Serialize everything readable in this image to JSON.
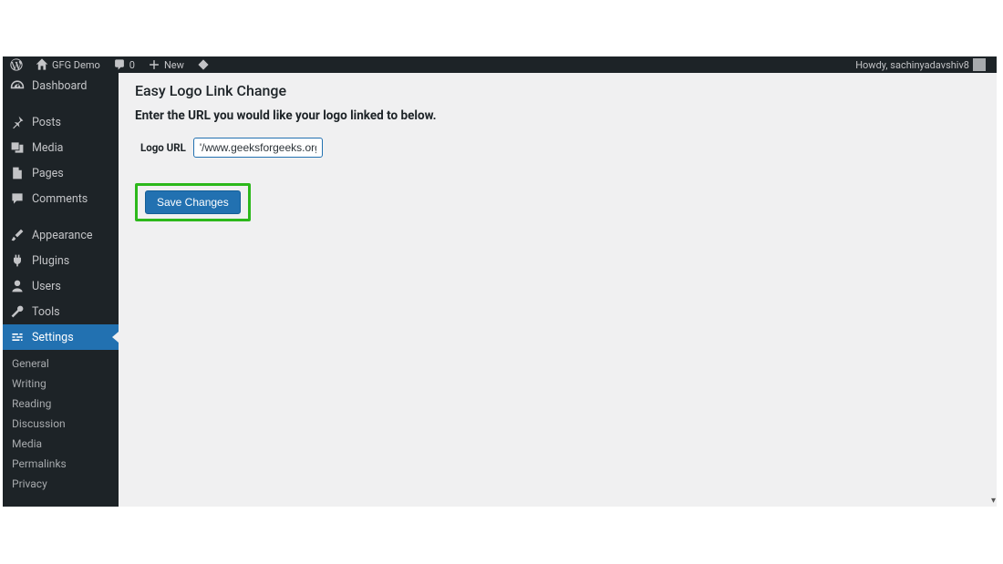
{
  "topbar": {
    "site_name": "GFG Demo",
    "comments_count": "0",
    "new_label": "New",
    "howdy": "Howdy, sachinyadavshiv8"
  },
  "sidebar": {
    "items": [
      {
        "id": "dashboard",
        "label": "Dashboard"
      },
      {
        "id": "posts",
        "label": "Posts"
      },
      {
        "id": "media",
        "label": "Media"
      },
      {
        "id": "pages",
        "label": "Pages"
      },
      {
        "id": "comments",
        "label": "Comments"
      },
      {
        "id": "appearance",
        "label": "Appearance"
      },
      {
        "id": "plugins",
        "label": "Plugins"
      },
      {
        "id": "users",
        "label": "Users"
      },
      {
        "id": "tools",
        "label": "Tools"
      },
      {
        "id": "settings",
        "label": "Settings"
      }
    ],
    "submenu": [
      "General",
      "Writing",
      "Reading",
      "Discussion",
      "Media",
      "Permalinks",
      "Privacy"
    ]
  },
  "page": {
    "title": "Easy Logo Link Change",
    "subtitle": "Enter the URL you would like your logo linked to below.",
    "logo_url_label": "Logo URL",
    "logo_url_value": "'/www.geeksforgeeks.org/",
    "save_label": "Save Changes"
  }
}
